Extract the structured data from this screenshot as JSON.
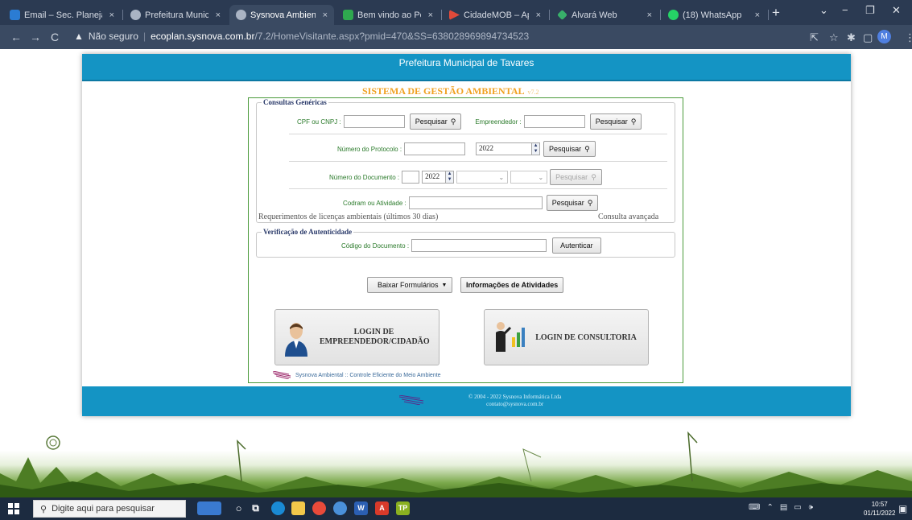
{
  "browser": {
    "tabs": [
      {
        "label": "Email – Sec. Planejamer",
        "icon": "outlook-icon",
        "color": "#2b7cd3",
        "active": false
      },
      {
        "label": "Prefeitura Municipal de",
        "icon": "globe-icon",
        "color": "#aab4c4",
        "active": false
      },
      {
        "label": "Sysnova Ambiental",
        "icon": "globe-icon",
        "color": "#aab4c4",
        "active": true
      },
      {
        "label": "Bem vindo ao Portal do",
        "icon": "portal-icon",
        "color": "#2fa84f",
        "active": false
      },
      {
        "label": "CidadeMOB – Apps no",
        "icon": "play-store-icon",
        "color": "#e04a3a",
        "active": false
      },
      {
        "label": "Alvará Web",
        "icon": "diamond-icon",
        "color": "#38b06a",
        "active": false
      },
      {
        "label": "(18) WhatsApp",
        "icon": "whatsapp-icon",
        "color": "#25d366",
        "active": false
      }
    ],
    "close_glyph": "×",
    "new_tab_glyph": "+",
    "address": {
      "warning": "Não seguro",
      "domain": "ecoplan.sysnova.com.br",
      "path": "/7.2/HomeVisitante.aspx?pmid=470&SS=638028969894734523"
    },
    "profile_initial": "M"
  },
  "page": {
    "header_title": "Prefeitura Municipal de Tavares",
    "system_title": "SISTEMA DE GESTÃO AMBIENTAL",
    "system_version": "v7.2",
    "generic_queries": {
      "legend": "Consultas Genéricas",
      "cpf_label": "CPF ou CNPJ :",
      "cpf_value": "",
      "search_label": "Pesquisar",
      "entrepreneur_label": "Empreendedor :",
      "entrepreneur_value": "",
      "protocol_label": "Número do Protocolo :",
      "protocol_value": "",
      "protocol_year": "2022",
      "document_label": "Número do Documento :",
      "document_value": "",
      "document_year": "2022",
      "activity_label": "Codram ou Atividade :",
      "activity_value": "",
      "requirements_link": "Requerimentos de licenças ambientais (últimos 30 dias)",
      "advanced_link": "Consulta avançada"
    },
    "authenticity": {
      "legend": "Verificação de Autenticidade",
      "code_label": "Código do Documento :",
      "code_value": "",
      "auth_button": "Autenticar"
    },
    "actions": {
      "forms_button": "Baixar Formulários",
      "activities_button": "Informações de Atividades"
    },
    "login": {
      "entrepreneur_line1": "LOGIN DE",
      "entrepreneur_line2": "EMPREENDEDOR/CIDADÃO",
      "consultancy": "LOGIN DE CONSULTORIA"
    },
    "credit": "Sysnova Ambiental :: Controle Eficiente do Meio Ambiente",
    "footer_line1": "© 2004 - 2022 Sysnova Informática Ltda",
    "footer_line2": "contato@sysnova.com.br"
  },
  "taskbar": {
    "search_placeholder": "Digite aqui para pesquisar",
    "time": "10:57",
    "date": "01/11/2022"
  }
}
